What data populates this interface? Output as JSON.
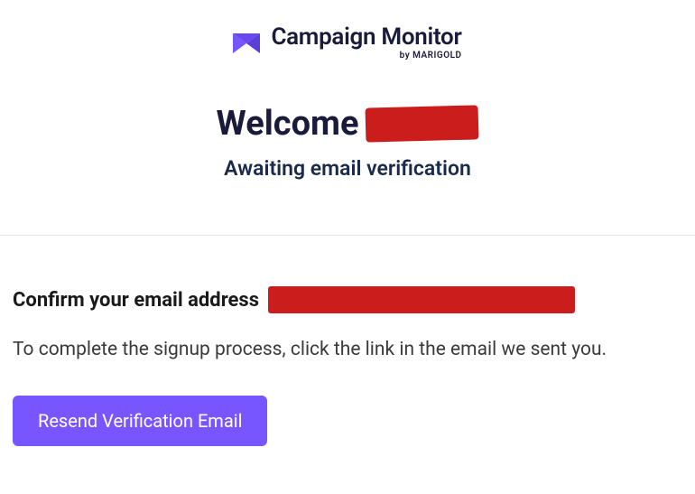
{
  "header": {
    "brand_name": "Campaign Monitor",
    "brand_by": "by MARIGOLD",
    "icon": "campaign-monitor-logo"
  },
  "welcome": {
    "title": "Welcome",
    "subtitle": "Awaiting email verification"
  },
  "body": {
    "confirm_label": "Confirm your email address",
    "instruction": "To complete the signup process, click the link in the email we sent you.",
    "resend_button_label": "Resend Verification Email"
  },
  "colors": {
    "accent": "#7856ff",
    "redaction": "#cc1d1d",
    "text_dark": "#1a1a3a"
  }
}
